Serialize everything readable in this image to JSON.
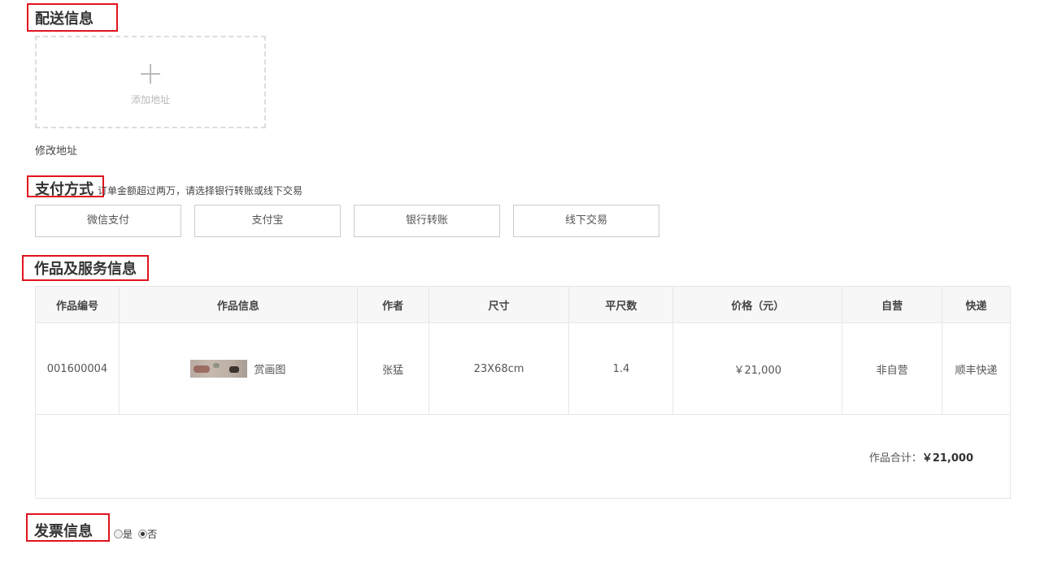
{
  "delivery": {
    "title": "配送信息",
    "add_address_label": "添加地址",
    "edit_address_link": "修改地址"
  },
  "payment": {
    "title": "支付方式",
    "note": "订单金额超过两万，请选择银行转账或线下交易",
    "options": [
      "微信支付",
      "支付宝",
      "银行转账",
      "线下交易"
    ]
  },
  "products": {
    "title": "作品及服务信息",
    "columns": [
      "作品编号",
      "作品信息",
      "作者",
      "尺寸",
      "平尺数",
      "价格（元）",
      "自营",
      "快递"
    ],
    "rows": [
      {
        "id": "001600004",
        "name": "赏画图",
        "author": "张猛",
        "size": "23X68cm",
        "sqft": "1.4",
        "price": "￥21,000",
        "self_operated": "非自营",
        "shipping": "顺丰快递"
      }
    ],
    "total_label": "作品合计：",
    "total_value": "￥21,000"
  },
  "invoice": {
    "title": "发票信息",
    "options": [
      {
        "label": "是",
        "checked": false
      },
      {
        "label": "否",
        "checked": true
      }
    ]
  }
}
